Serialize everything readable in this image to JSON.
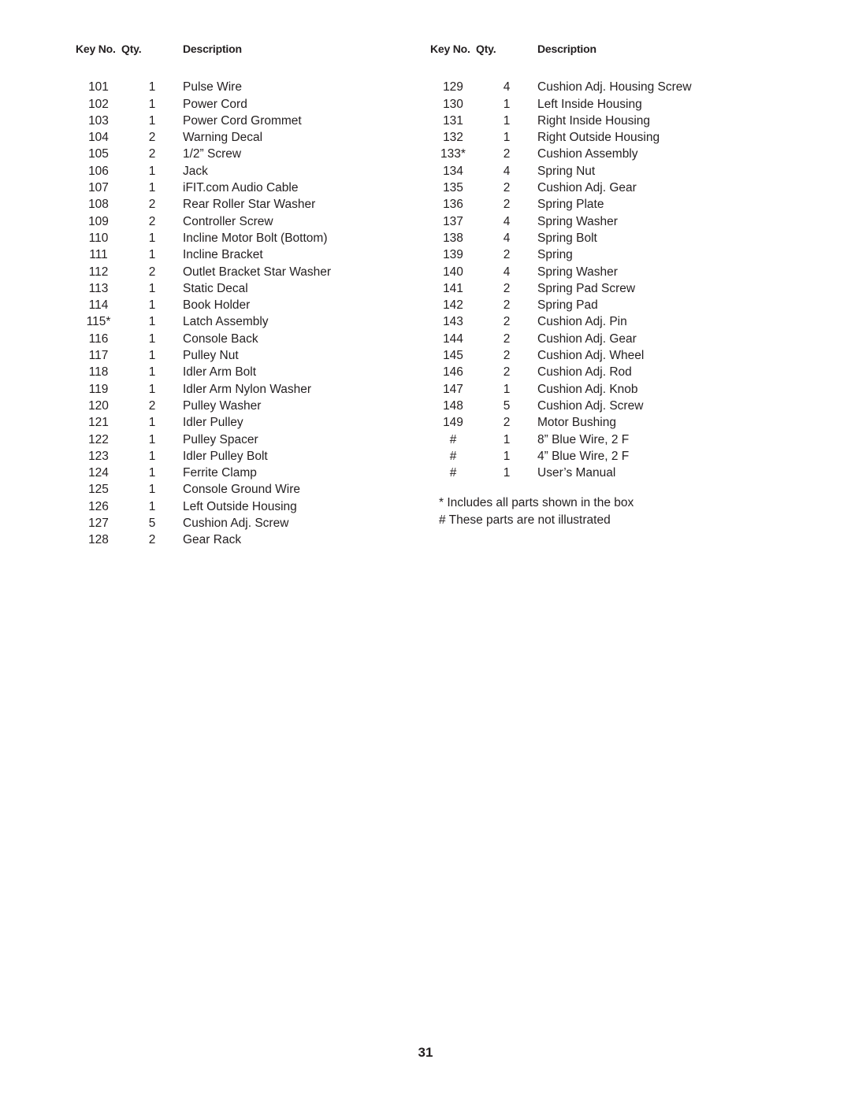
{
  "page": {
    "number": "31"
  },
  "columns": [
    {
      "headers": {
        "key_no": "Key No.",
        "qty": "Qty.",
        "description": "Description"
      },
      "rows": [
        {
          "key": "101",
          "qty": "1",
          "desc": "Pulse Wire"
        },
        {
          "key": "102",
          "qty": "1",
          "desc": "Power Cord"
        },
        {
          "key": "103",
          "qty": "1",
          "desc": "Power Cord Grommet"
        },
        {
          "key": "104",
          "qty": "2",
          "desc": "Warning Decal"
        },
        {
          "key": "105",
          "qty": "2",
          "desc": "1/2” Screw"
        },
        {
          "key": "106",
          "qty": "1",
          "desc": "Jack"
        },
        {
          "key": "107",
          "qty": "1",
          "desc": "iFIT.com Audio Cable"
        },
        {
          "key": "108",
          "qty": "2",
          "desc": "Rear Roller Star Washer"
        },
        {
          "key": "109",
          "qty": "2",
          "desc": "Controller Screw"
        },
        {
          "key": "110",
          "qty": "1",
          "desc": "Incline Motor Bolt (Bottom)"
        },
        {
          "key": "111",
          "qty": "1",
          "desc": "Incline Bracket"
        },
        {
          "key": "112",
          "qty": "2",
          "desc": "Outlet Bracket Star Washer"
        },
        {
          "key": "113",
          "qty": "1",
          "desc": "Static Decal"
        },
        {
          "key": "114",
          "qty": "1",
          "desc": "Book Holder"
        },
        {
          "key": "115*",
          "qty": "1",
          "desc": "Latch Assembly"
        },
        {
          "key": "116",
          "qty": "1",
          "desc": "Console Back"
        },
        {
          "key": "117",
          "qty": "1",
          "desc": "Pulley Nut"
        },
        {
          "key": "118",
          "qty": "1",
          "desc": "Idler Arm Bolt"
        },
        {
          "key": "119",
          "qty": "1",
          "desc": "Idler Arm Nylon Washer"
        },
        {
          "key": "120",
          "qty": "2",
          "desc": "Pulley Washer"
        },
        {
          "key": "121",
          "qty": "1",
          "desc": "Idler Pulley"
        },
        {
          "key": "122",
          "qty": "1",
          "desc": "Pulley Spacer"
        },
        {
          "key": "123",
          "qty": "1",
          "desc": "Idler Pulley Bolt"
        },
        {
          "key": "124",
          "qty": "1",
          "desc": "Ferrite Clamp"
        },
        {
          "key": "125",
          "qty": "1",
          "desc": "Console Ground Wire"
        },
        {
          "key": "126",
          "qty": "1",
          "desc": "Left Outside Housing"
        },
        {
          "key": "127",
          "qty": "5",
          "desc": "Cushion Adj. Screw"
        },
        {
          "key": "128",
          "qty": "2",
          "desc": "Gear Rack"
        }
      ],
      "footnotes": []
    },
    {
      "headers": {
        "key_no": "Key No.",
        "qty": "Qty.",
        "description": "Description"
      },
      "rows": [
        {
          "key": "129",
          "qty": "4",
          "desc": "Cushion Adj. Housing Screw"
        },
        {
          "key": "130",
          "qty": "1",
          "desc": "Left Inside Housing"
        },
        {
          "key": "131",
          "qty": "1",
          "desc": "Right Inside Housing"
        },
        {
          "key": "132",
          "qty": "1",
          "desc": "Right Outside Housing"
        },
        {
          "key": "133*",
          "qty": "2",
          "desc": "Cushion Assembly"
        },
        {
          "key": "134",
          "qty": "4",
          "desc": "Spring Nut"
        },
        {
          "key": "135",
          "qty": "2",
          "desc": "Cushion Adj. Gear"
        },
        {
          "key": "136",
          "qty": "2",
          "desc": "Spring Plate"
        },
        {
          "key": "137",
          "qty": "4",
          "desc": "Spring Washer"
        },
        {
          "key": "138",
          "qty": "4",
          "desc": "Spring Bolt"
        },
        {
          "key": "139",
          "qty": "2",
          "desc": "Spring"
        },
        {
          "key": "140",
          "qty": "4",
          "desc": "Spring Washer"
        },
        {
          "key": "141",
          "qty": "2",
          "desc": "Spring Pad Screw"
        },
        {
          "key": "142",
          "qty": "2",
          "desc": "Spring Pad"
        },
        {
          "key": "143",
          "qty": "2",
          "desc": "Cushion Adj. Pin"
        },
        {
          "key": "144",
          "qty": "2",
          "desc": "Cushion Adj. Gear"
        },
        {
          "key": "145",
          "qty": "2",
          "desc": "Cushion Adj. Wheel"
        },
        {
          "key": "146",
          "qty": "2",
          "desc": "Cushion Adj. Rod"
        },
        {
          "key": "147",
          "qty": "1",
          "desc": "Cushion Adj. Knob"
        },
        {
          "key": "148",
          "qty": "5",
          "desc": "Cushion Adj. Screw"
        },
        {
          "key": "149",
          "qty": "2",
          "desc": "Motor Bushing"
        },
        {
          "key": "#",
          "qty": "1",
          "desc": "8” Blue Wire, 2 F"
        },
        {
          "key": "#",
          "qty": "1",
          "desc": "4” Blue Wire, 2 F"
        },
        {
          "key": "#",
          "qty": "1",
          "desc": "User’s Manual"
        }
      ],
      "footnotes": [
        "*  Includes all parts shown in the box",
        "# These parts are not illustrated"
      ]
    }
  ]
}
